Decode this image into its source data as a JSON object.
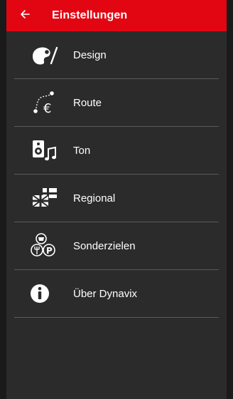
{
  "appbar": {
    "title": "Einstellungen",
    "back_icon": "arrow-left-icon",
    "color": "#e20613"
  },
  "menu": {
    "items": [
      {
        "label": "Design",
        "icon": "palette-icon"
      },
      {
        "label": "Route",
        "icon": "route-icon"
      },
      {
        "label": "Ton",
        "icon": "speaker-icon"
      },
      {
        "label": "Regional",
        "icon": "flags-icon"
      },
      {
        "label": "Sonderzielen",
        "icon": "poi-icon"
      },
      {
        "label": "Über Dynavix",
        "icon": "info-icon"
      }
    ]
  },
  "colors": {
    "background": "#2b2b2b",
    "divider": "#5a5a5a",
    "text": "#ffffff"
  }
}
